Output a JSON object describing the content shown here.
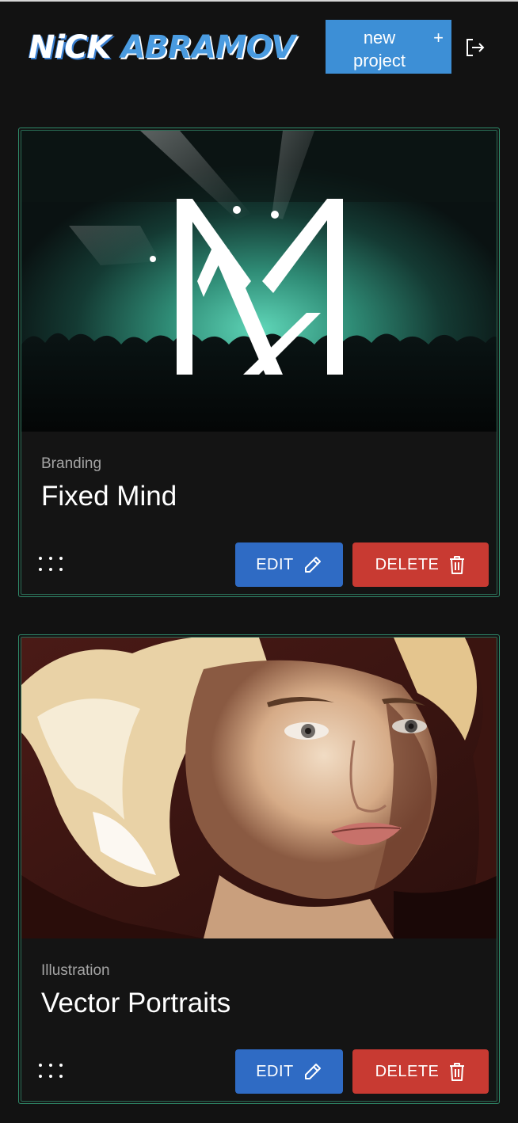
{
  "header": {
    "logo_first": "NiCK",
    "logo_last": "ABRAMOV",
    "new_project_label": "new\nproject",
    "new_project_icon": "+",
    "logout_icon": "logout-icon"
  },
  "projects": [
    {
      "category": "Branding",
      "title": "Fixed Mind",
      "edit_label": "EDIT",
      "delete_label": "DELETE"
    },
    {
      "category": "Illustration",
      "title": "Vector Portraits",
      "edit_label": "EDIT",
      "delete_label": "DELETE"
    }
  ],
  "colors": {
    "background": "#121212",
    "accent_blue": "#3d8fd6",
    "edit_blue": "#2f6bc4",
    "delete_red": "#c83a32",
    "card_border": "#2f8a6a"
  }
}
